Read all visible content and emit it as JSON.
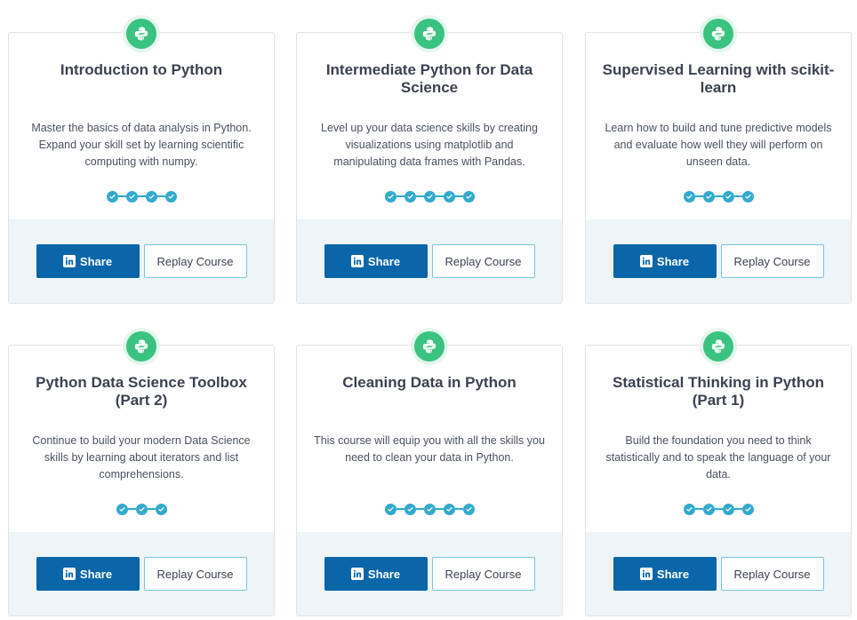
{
  "colors": {
    "accent_green": "#3ac280",
    "progress_blue": "#33aacc",
    "share_blue": "#0a66a9",
    "footer_bg": "#edf5f8",
    "replay_border": "#7cc6dd"
  },
  "icons": {
    "course_badge": "python-icon",
    "progress_step": "check-icon",
    "share_button": "linkedin-icon"
  },
  "courses": [
    {
      "title": "Introduction to Python",
      "description": "Master the basics of data analysis in Python. Expand your skill set by learning scientific computing with numpy.",
      "chapters_completed": 4,
      "share_label": "Share",
      "replay_label": "Replay Course"
    },
    {
      "title": "Intermediate Python for Data Science",
      "description": "Level up your data science skills by creating visualizations using matplotlib and manipulating data frames with Pandas.",
      "chapters_completed": 5,
      "share_label": "Share",
      "replay_label": "Replay Course"
    },
    {
      "title": "Supervised Learning with scikit-learn",
      "description": "Learn how to build and tune predictive models and evaluate how well they will perform on unseen data.",
      "chapters_completed": 4,
      "share_label": "Share",
      "replay_label": "Replay Course"
    },
    {
      "title": "Python Data Science Toolbox (Part 2)",
      "description": "Continue to build your modern Data Science skills by learning about iterators and list comprehensions.",
      "chapters_completed": 3,
      "share_label": "Share",
      "replay_label": "Replay Course"
    },
    {
      "title": "Cleaning Data in Python",
      "description": "This course will equip you with all the skills you need to clean your data in Python.",
      "chapters_completed": 5,
      "share_label": "Share",
      "replay_label": "Replay Course"
    },
    {
      "title": "Statistical Thinking in Python (Part 1)",
      "description": "Build the foundation you need to think statistically and to speak the language of your data.",
      "chapters_completed": 4,
      "share_label": "Share",
      "replay_label": "Replay Course"
    }
  ]
}
